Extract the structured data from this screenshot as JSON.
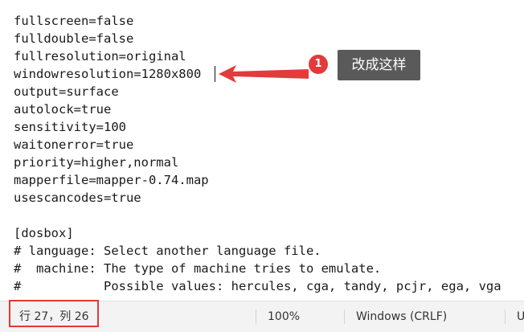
{
  "editor": {
    "lines": [
      "fullscreen=false",
      "fulldouble=false",
      "fullresolution=original",
      "windowresolution=1280x800",
      "output=surface",
      "autolock=true",
      "sensitivity=100",
      "waitonerror=true",
      "priority=higher,normal",
      "mapperfile=mapper-0.74.map",
      "usescancodes=true",
      "",
      "[dosbox]",
      "# language: Select another language file.",
      "#  machine: The type of machine tries to emulate.",
      "#           Possible values: hercules, cga, tandy, pcjr, ega, vga"
    ]
  },
  "annotation": {
    "badge_number": "1",
    "callout_text": "改成这样",
    "accent_color": "#e23b3b"
  },
  "statusbar": {
    "cursor_position": "行 27，列 26",
    "zoom": "100%",
    "line_ending": "Windows (CRLF)",
    "encoding": "U"
  }
}
